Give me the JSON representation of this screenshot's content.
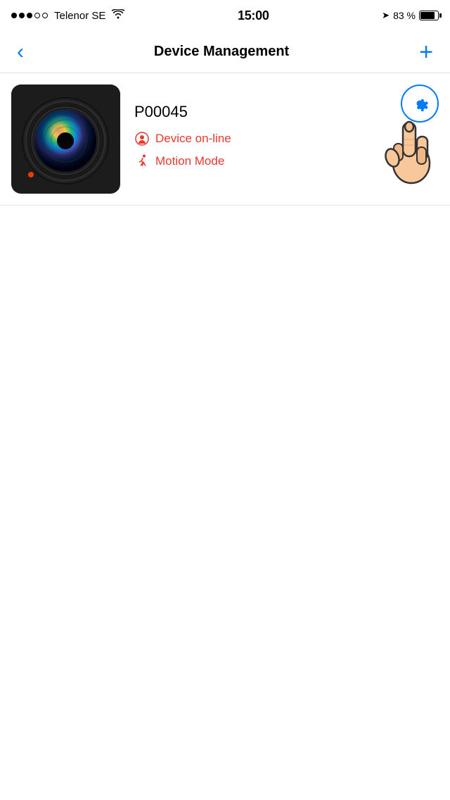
{
  "statusBar": {
    "carrier": "Telenor SE",
    "time": "15:00",
    "battery_percent": "83 %"
  },
  "navBar": {
    "title": "Device Management",
    "back_label": "‹",
    "add_label": "+"
  },
  "device": {
    "name": "P00045",
    "status": "Device on-line",
    "mode": "Motion Mode",
    "status_icon": "📷",
    "mode_icon": "🏃"
  },
  "colors": {
    "accent": "#007aff",
    "status_red": "#e8382f"
  }
}
